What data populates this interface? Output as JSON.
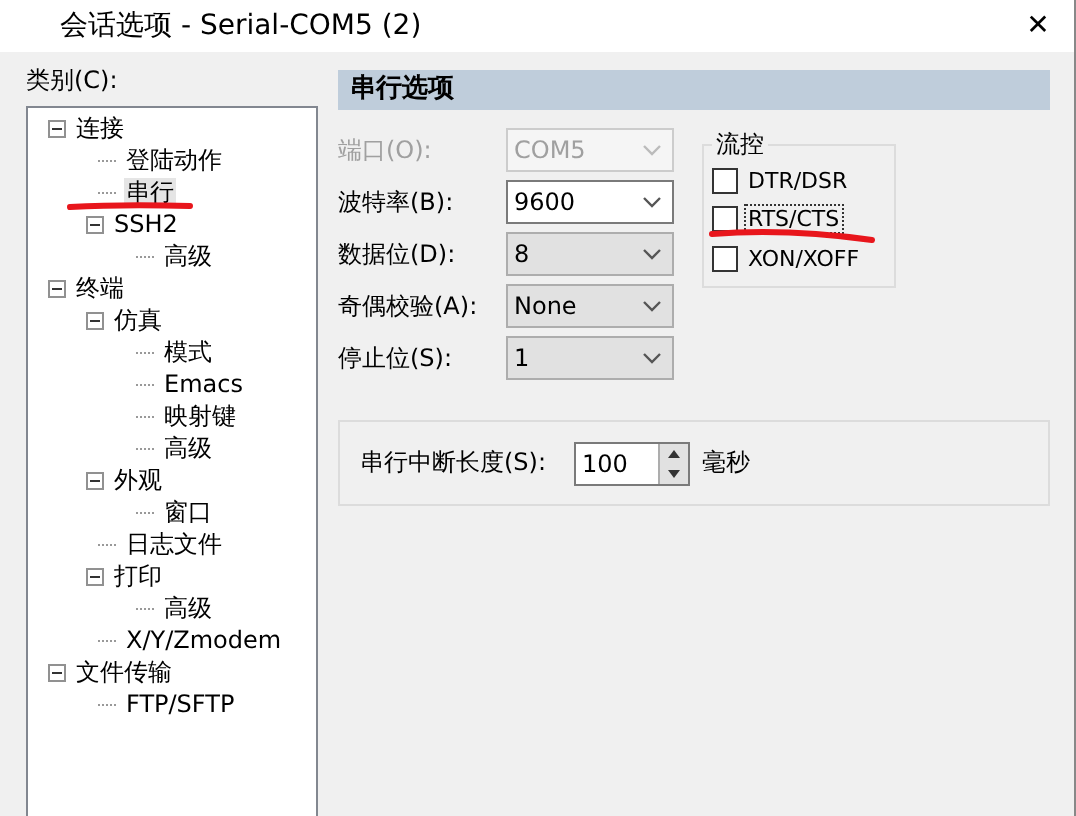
{
  "window": {
    "title": "会话选项 - Serial-COM5 (2)",
    "close": "✕"
  },
  "category_label": "类别(C):",
  "tree": [
    {
      "label": "连接",
      "expanded": true,
      "selected": false,
      "children": [
        {
          "label": "登陆动作",
          "selected": false
        },
        {
          "label": "串行",
          "selected": true
        },
        {
          "label": "SSH2",
          "expanded": true,
          "selected": false,
          "children": [
            {
              "label": "高级",
              "selected": false
            }
          ]
        }
      ]
    },
    {
      "label": "终端",
      "expanded": true,
      "selected": false,
      "children": [
        {
          "label": "仿真",
          "expanded": true,
          "selected": false,
          "children": [
            {
              "label": "模式",
              "selected": false
            },
            {
              "label": "Emacs",
              "selected": false
            },
            {
              "label": "映射键",
              "selected": false
            },
            {
              "label": "高级",
              "selected": false
            }
          ]
        },
        {
          "label": "外观",
          "expanded": true,
          "selected": false,
          "children": [
            {
              "label": "窗口",
              "selected": false
            }
          ]
        },
        {
          "label": "日志文件",
          "selected": false
        },
        {
          "label": "打印",
          "expanded": true,
          "selected": false,
          "children": [
            {
              "label": "高级",
              "selected": false
            }
          ]
        },
        {
          "label": "X/Y/Zmodem",
          "selected": false
        }
      ]
    },
    {
      "label": "文件传输",
      "expanded": true,
      "selected": false,
      "children": [
        {
          "label": "FTP/SFTP",
          "selected": false
        }
      ]
    }
  ],
  "panel": {
    "header": "串行选项",
    "fields": [
      {
        "label": "端口(O):",
        "value": "COM5",
        "kind": "dropdown",
        "disabled": true
      },
      {
        "label": "波特率(B):",
        "value": "9600",
        "kind": "editable",
        "disabled": false
      },
      {
        "label": "数据位(D):",
        "value": "8",
        "kind": "dropdown",
        "disabled": false
      },
      {
        "label": "奇偶校验(A):",
        "value": "None",
        "kind": "dropdown",
        "disabled": false
      },
      {
        "label": "停止位(S):",
        "value": "1",
        "kind": "dropdown",
        "disabled": false
      }
    ],
    "flow_control": {
      "title": "流控",
      "options": [
        {
          "label": "DTR/DSR",
          "checked": false,
          "focused": false
        },
        {
          "label": "RTS/CTS",
          "checked": false,
          "focused": true
        },
        {
          "label": "XON/XOFF",
          "checked": false,
          "focused": false
        }
      ]
    },
    "break_length": {
      "label": "串行中断长度(S):",
      "value": "100",
      "unit": "毫秒"
    }
  }
}
